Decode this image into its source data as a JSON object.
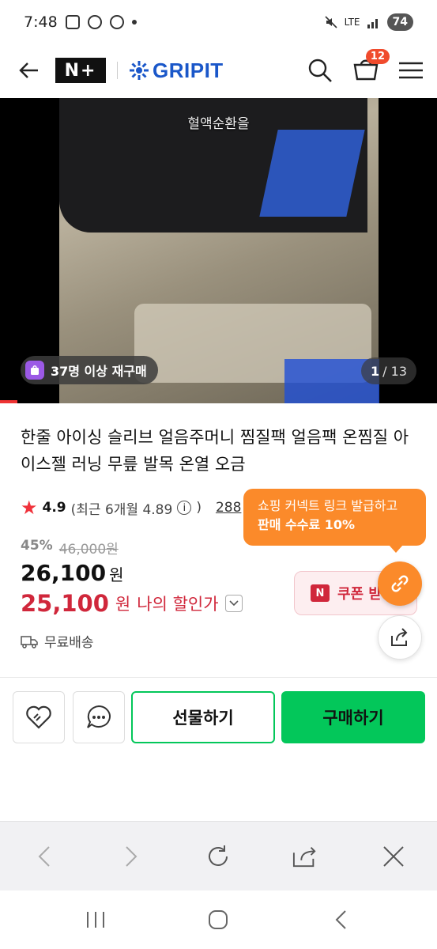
{
  "status_bar": {
    "time": "7:48",
    "network": "LTE",
    "battery": "74"
  },
  "header": {
    "service_badge": "N+",
    "brand": "GRIPIT",
    "cart_count": "12"
  },
  "hero": {
    "caption": "혈액순환을",
    "rebuy_label": "37명 이상 재구매",
    "page_current": "1",
    "page_total": "/ 13"
  },
  "product": {
    "title": "한줄 아이싱 슬리브 얼음주머니 찜질팩 얼음팩 온찜질 아이스젤 러닝 무릎 발목 온열 오금",
    "rating": "4.9",
    "rating_recent": "(최근 6개월 4.89",
    "rating_close": ")",
    "review_count": "288",
    "discount_rate": "45%",
    "original_price": "46,000원",
    "price": "26,100",
    "price_unit": "원",
    "my_price": "25,100",
    "my_price_unit": "원",
    "my_price_label": "나의 할인가",
    "shipping": "무료배송"
  },
  "coupon": {
    "badge": "N",
    "label": "쿠폰 받기"
  },
  "tooltip": {
    "line1": "쇼핑 커넥트 링크 발급하고",
    "line2": "판매 수수료 10%"
  },
  "actions": {
    "gift": "선물하기",
    "buy": "구매하기"
  },
  "colors": {
    "accent_green": "#03c75a",
    "discount_red": "#d0273b",
    "tooltip_orange": "#fb8a2a",
    "brand_blue": "#1a57c9"
  }
}
